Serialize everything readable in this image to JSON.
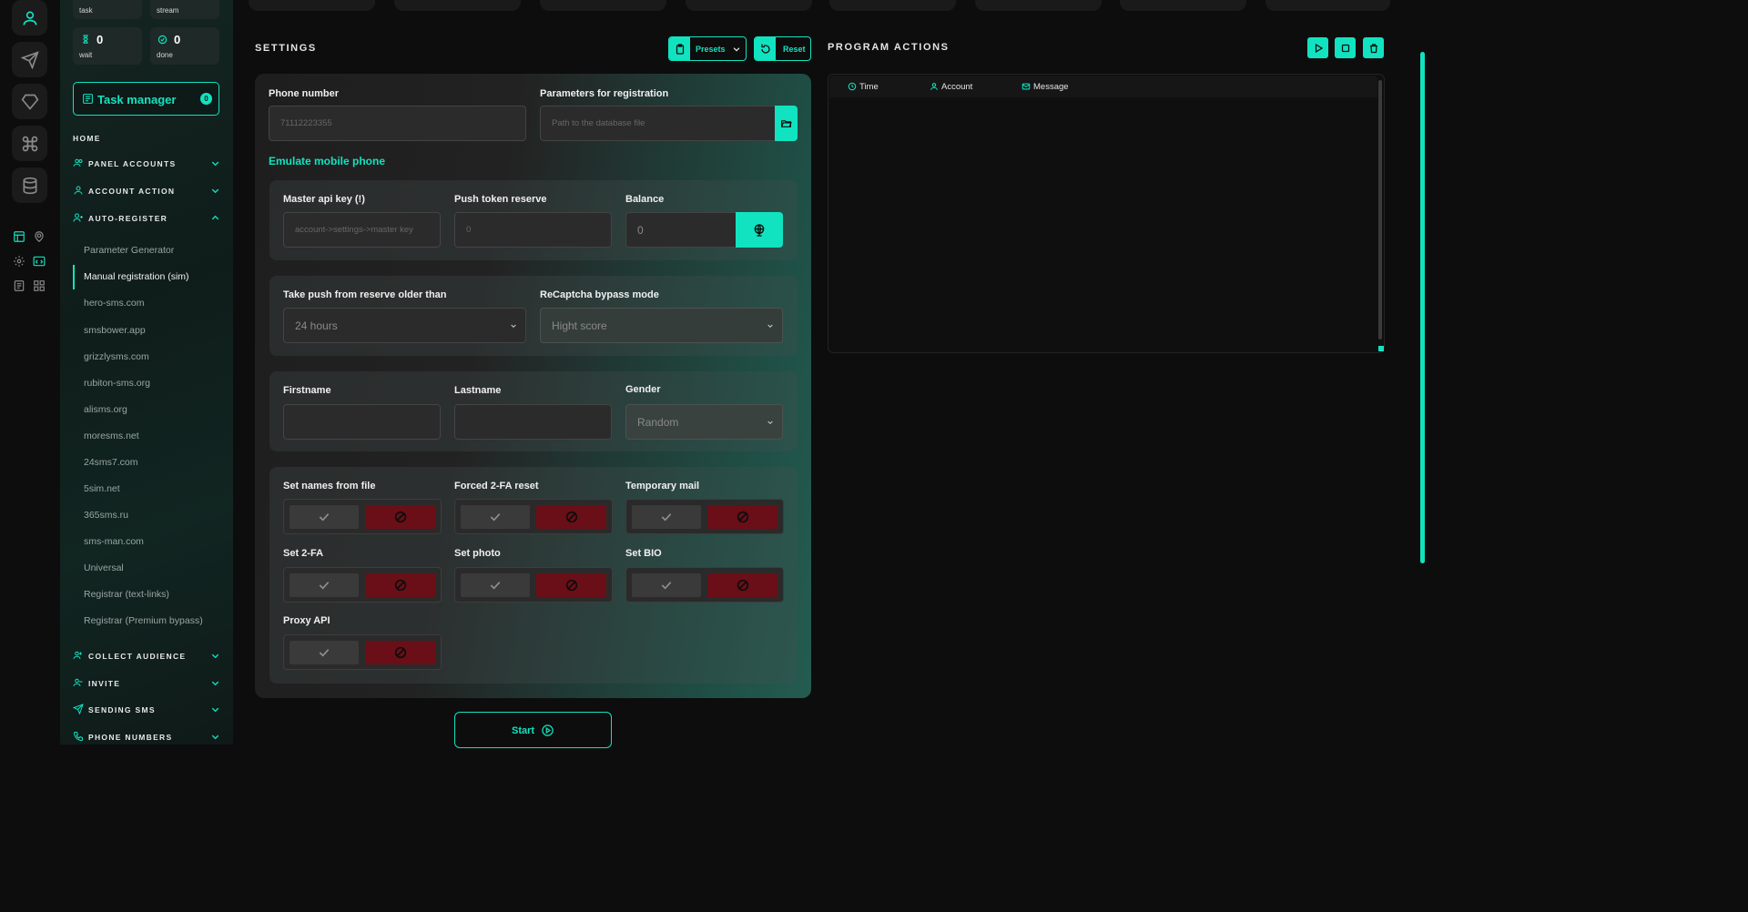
{
  "sidebar": {
    "stats": [
      {
        "label": "task",
        "value": ""
      },
      {
        "label": "stream",
        "value": ""
      },
      {
        "label": "wait",
        "value": "0"
      },
      {
        "label": "done",
        "value": "0"
      }
    ],
    "task_manager": {
      "label": "Task manager",
      "badge": "0"
    },
    "home": "HOME",
    "sections": [
      {
        "label": "PANEL ACCOUNTS",
        "icon": "users-icon",
        "expanded": false
      },
      {
        "label": "ACCOUNT ACTION",
        "icon": "user-icon",
        "expanded": false
      },
      {
        "label": "AUTO-REGISTER",
        "icon": "user-plus-icon",
        "expanded": true
      },
      {
        "label": "COLLECT AUDIENCE",
        "icon": "group-icon",
        "expanded": false
      },
      {
        "label": "INVITE",
        "icon": "group-icon",
        "expanded": false
      },
      {
        "label": "SENDING SMS",
        "icon": "send-icon",
        "expanded": false
      },
      {
        "label": "PHONE NUMBERS",
        "icon": "phone-icon",
        "expanded": false
      }
    ],
    "auto_register_items": [
      "Parameter Generator",
      "Manual registration (sim)",
      "hero-sms.com",
      "smsbower.app",
      "grizzlysms.com",
      "rubiton-sms.org",
      "alisms.org",
      "moresms.net",
      "24sms7.com",
      "5sim.net",
      "365sms.ru",
      "sms-man.com",
      "Universal",
      "Registrar (text-links)",
      "Registrar (Premium bypass)"
    ],
    "active_item": "Manual registration (sim)"
  },
  "settings": {
    "title": "SETTINGS",
    "presets_label": "Presets",
    "reset_label": "Reset",
    "phone_number": {
      "label": "Phone number",
      "value": "71112223355"
    },
    "params": {
      "label": "Parameters for registration",
      "placeholder": "Path to the database file"
    },
    "emulate_label": "Emulate mobile phone",
    "master_api": {
      "label": "Master api key (!)",
      "placeholder": "account->settings->master key"
    },
    "push_token": {
      "label": "Push token reserve",
      "value": "0"
    },
    "balance": {
      "label": "Balance",
      "value": "0"
    },
    "take_push": {
      "label": "Take push from reserve older than",
      "value": "24 hours"
    },
    "recaptcha": {
      "label": "ReCaptcha bypass mode",
      "value": "Hight score"
    },
    "firstname": {
      "label": "Firstname",
      "value": ""
    },
    "lastname": {
      "label": "Lastname",
      "value": ""
    },
    "gender": {
      "label": "Gender",
      "value": "Random"
    },
    "toggles": [
      {
        "label": "Set names from file"
      },
      {
        "label": "Forced 2-FA reset"
      },
      {
        "label": "Temporary mail"
      },
      {
        "label": "Set 2-FA"
      },
      {
        "label": "Set photo"
      },
      {
        "label": "Set BIO"
      },
      {
        "label": "Proxy API"
      }
    ],
    "start_label": "Start"
  },
  "program_actions": {
    "title": "PROGRAM ACTIONS",
    "columns": [
      "Time",
      "Account",
      "Message"
    ]
  },
  "colors": {
    "accent": "#11e3c0",
    "danger": "#6a0f17",
    "background": "#0d0d0d"
  }
}
